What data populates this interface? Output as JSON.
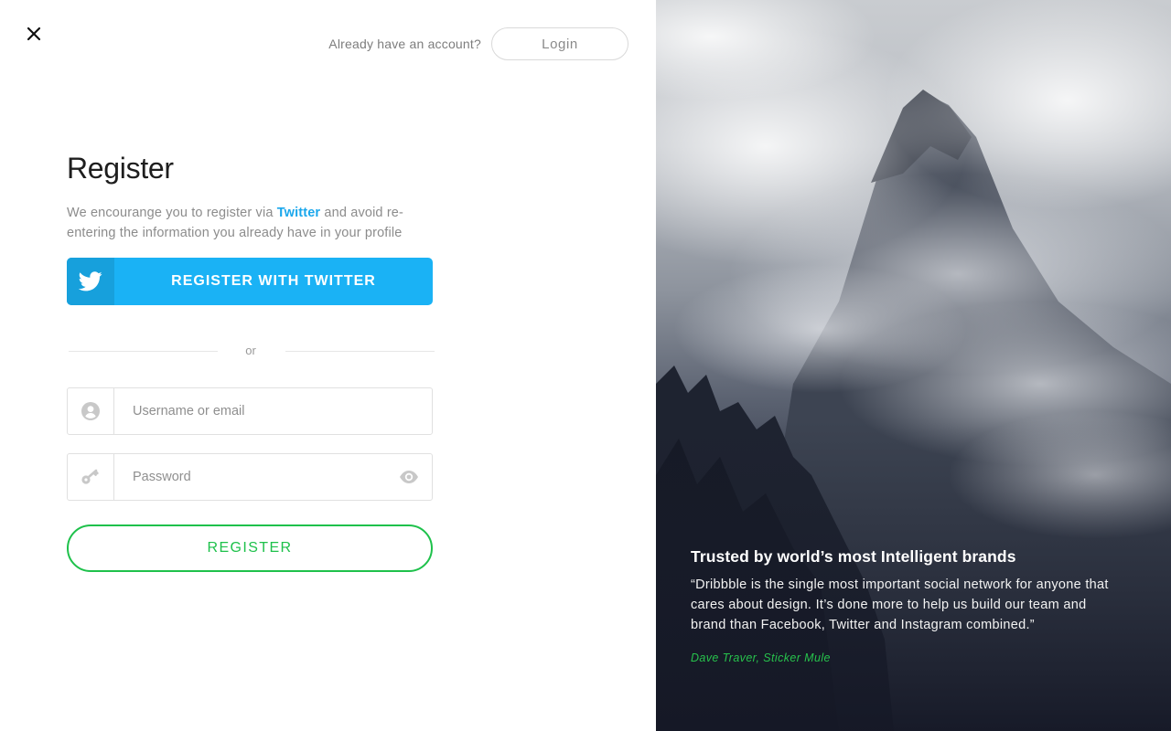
{
  "header": {
    "account_hint": "Already have an account?",
    "login_label": "Login"
  },
  "form": {
    "title": "Register",
    "intro_before": "We encourange you to register via ",
    "intro_link": "Twitter",
    "intro_after": " and avoid re-entering the information you already have in your profile",
    "twitter_button_label": "REGISTER WITH TWITTER",
    "divider_text": "or",
    "username_placeholder": "Username or email",
    "password_placeholder": "Password",
    "register_label": "REGISTER"
  },
  "testimonial": {
    "title": "Trusted by world’s most Intelligent brands",
    "quote": "“Dribbble is the single most important social network for anyone that cares about design. It’s done more to help us build our team and brand than Facebook, Twitter and Instagram combined.”",
    "author": "Dave Traver, Sticker Mule"
  },
  "colors": {
    "twitter_blue": "#1ab2f5",
    "twitter_blue_dark": "#17a0dc",
    "accent_green": "#1ec14b",
    "link_blue": "#1aa7ec"
  },
  "icons": {
    "close": "close-icon",
    "twitter": "twitter-bird-icon",
    "user": "user-circle-icon",
    "password": "key-icon",
    "reveal": "eye-icon"
  }
}
